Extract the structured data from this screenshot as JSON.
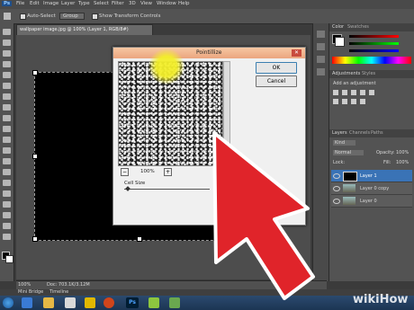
{
  "menu": {
    "ps_logo": "Ps",
    "items": [
      "File",
      "Edit",
      "Image",
      "Layer",
      "Type",
      "Select",
      "Filter",
      "3D",
      "View",
      "Window",
      "Help"
    ]
  },
  "options": {
    "auto_select": "Auto-Select",
    "group": "Group",
    "transform": "Show Transform Controls"
  },
  "document": {
    "tab": "wallpaper image.jpg @ 100% (Layer 1, RGB/8#)",
    "zoom": "100%",
    "doc_size": "Doc: 703.1K/3.12M"
  },
  "dialog": {
    "title": "Pointillize",
    "ok": "OK",
    "cancel": "Cancel",
    "zoom": "100%",
    "cell_size_label": "Cell Size"
  },
  "panels": {
    "color_tab": "Color",
    "swatches_tab": "Swatches",
    "adjustments_tab": "Adjustments",
    "styles_tab": "Styles",
    "add_adjustment": "Add an adjustment",
    "layers_tab": "Layers",
    "channels_tab": "Channels",
    "paths_tab": "Paths",
    "kind": "Kind",
    "blend_mode": "Normal",
    "opacity_label": "Opacity:",
    "opacity_value": "100%",
    "lock_label": "Lock:",
    "fill_label": "Fill:",
    "fill_value": "100%",
    "layers": [
      "Layer 1",
      "Layer 0 copy",
      "Layer 0"
    ]
  },
  "bottom": {
    "mini_bridge": "Mini Bridge",
    "timeline": "Timeline"
  },
  "watermark": "wikiHow",
  "colors": {
    "arrow": "#e0242a",
    "dialog_title": "#eba57e",
    "highlight": "#f3ef2a"
  }
}
